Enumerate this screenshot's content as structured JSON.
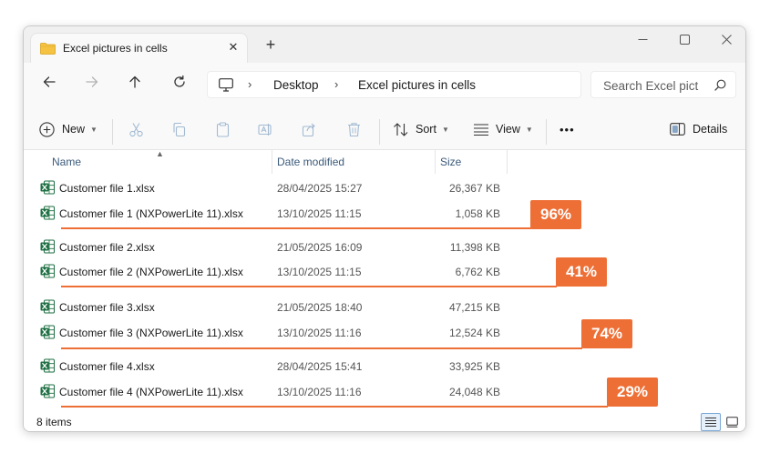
{
  "window": {
    "tab_title": "Excel pictures in cells",
    "new_tab_symbol": "+",
    "close_tab_symbol": "✕",
    "minimize_symbol": "—",
    "maximize_symbol": "☐",
    "close_symbol": "✕"
  },
  "navigation": {
    "back_icon": "arrow-left-icon",
    "forward_icon": "arrow-right-icon",
    "up_icon": "arrow-up-icon",
    "refresh_icon": "refresh-icon",
    "breadcrumb": [
      "Desktop",
      "Excel pictures in cells"
    ],
    "search_placeholder": "Search Excel pict"
  },
  "commandbar": {
    "new_label": "New",
    "sort_label": "Sort",
    "view_label": "View",
    "more_label": "•••",
    "details_label": "Details"
  },
  "columns": {
    "name": "Name",
    "date": "Date modified",
    "size": "Size"
  },
  "files": [
    {
      "name": "Customer file 1.xlsx",
      "date": "28/04/2025 15:27",
      "size": "26,367 KB"
    },
    {
      "name": "Customer file 1 (NXPowerLite 11).xlsx",
      "date": "13/10/2025 11:15",
      "size": "1,058 KB"
    },
    {
      "name": "Customer file 2.xlsx",
      "date": "21/05/2025 16:09",
      "size": "11,398 KB"
    },
    {
      "name": "Customer file 2 (NXPowerLite 11).xlsx",
      "date": "13/10/2025 11:15",
      "size": "6,762 KB"
    },
    {
      "name": "Customer file 3.xlsx",
      "date": "21/05/2025 18:40",
      "size": "47,215 KB"
    },
    {
      "name": "Customer file 3 (NXPowerLite 11).xlsx",
      "date": "13/10/2025 11:16",
      "size": "12,524 KB"
    },
    {
      "name": "Customer file 4.xlsx",
      "date": "28/04/2025 15:41",
      "size": "33,925 KB"
    },
    {
      "name": "Customer file 4 (NXPowerLite 11).xlsx",
      "date": "13/10/2025 11:16",
      "size": "24,048 KB"
    }
  ],
  "reductions": [
    {
      "label": "96%",
      "value": 96
    },
    {
      "label": "41%",
      "value": 41
    },
    {
      "label": "74%",
      "value": 74
    },
    {
      "label": "29%",
      "value": 29
    }
  ],
  "accent_color": "#ee6f36",
  "status": {
    "item_count": "8 items"
  }
}
